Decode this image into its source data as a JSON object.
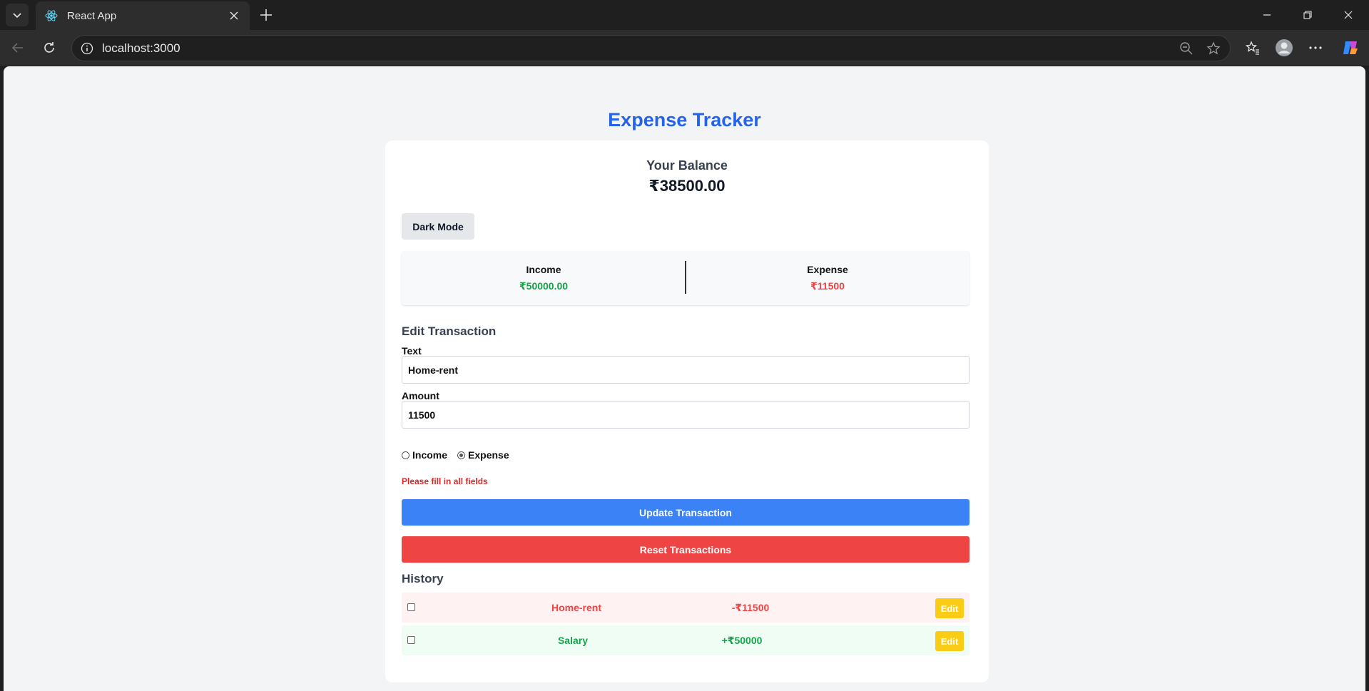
{
  "browser": {
    "tab_title": "React App",
    "url": "localhost:3000"
  },
  "app": {
    "title": "Expense Tracker",
    "balance_label": "Your Balance",
    "balance_value": "₹38500.00",
    "dark_mode_label": "Dark Mode"
  },
  "summary": {
    "income_label": "Income",
    "income_value": "₹50000.00",
    "expense_label": "Expense",
    "expense_value": "₹11500"
  },
  "form": {
    "heading": "Edit Transaction",
    "text_label": "Text",
    "text_value": "Home-rent",
    "amount_label": "Amount",
    "amount_value": "11500",
    "radio_income": "Income",
    "radio_expense": "Expense",
    "selected_type": "Expense",
    "error": "Please fill in all fields",
    "update_label": "Update Transaction",
    "reset_label": "Reset Transactions"
  },
  "history": {
    "heading": "History",
    "items": [
      {
        "text": "Home-rent",
        "amount": "-₹11500",
        "type": "expense",
        "edit": "Edit"
      },
      {
        "text": "Salary",
        "amount": "+₹50000",
        "type": "income",
        "edit": "Edit"
      }
    ]
  },
  "colors": {
    "title": "#2563eb",
    "income": "#16a34a",
    "expense": "#ef4444",
    "update_button": "#3b82f6",
    "reset_button": "#ef4444",
    "edit_button": "#facc15"
  }
}
